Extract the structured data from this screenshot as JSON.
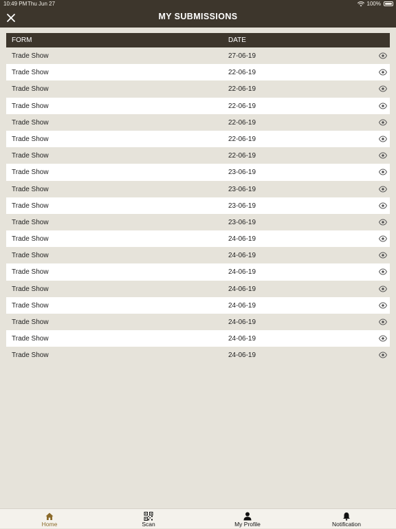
{
  "status": {
    "time": "10:49 PM",
    "date": "Thu Jun 27",
    "battery": "100%"
  },
  "nav": {
    "title": "MY SUBMISSIONS",
    "close_icon": "close-icon"
  },
  "table": {
    "headers": {
      "form": "FORM",
      "date": "DATE"
    },
    "rows": [
      {
        "form": "Trade Show",
        "date": "27-06-19"
      },
      {
        "form": "Trade Show",
        "date": "22-06-19"
      },
      {
        "form": "Trade Show",
        "date": "22-06-19"
      },
      {
        "form": "Trade Show",
        "date": "22-06-19"
      },
      {
        "form": "Trade Show",
        "date": "22-06-19"
      },
      {
        "form": "Trade Show",
        "date": "22-06-19"
      },
      {
        "form": "Trade Show",
        "date": "22-06-19"
      },
      {
        "form": "Trade Show",
        "date": "23-06-19"
      },
      {
        "form": "Trade Show",
        "date": "23-06-19"
      },
      {
        "form": "Trade Show",
        "date": "23-06-19"
      },
      {
        "form": "Trade Show",
        "date": "23-06-19"
      },
      {
        "form": "Trade Show",
        "date": "24-06-19"
      },
      {
        "form": "Trade Show",
        "date": "24-06-19"
      },
      {
        "form": "Trade Show",
        "date": "24-06-19"
      },
      {
        "form": "Trade Show",
        "date": "24-06-19"
      },
      {
        "form": "Trade Show",
        "date": "24-06-19"
      },
      {
        "form": "Trade Show",
        "date": "24-06-19"
      },
      {
        "form": "Trade Show",
        "date": "24-06-19"
      },
      {
        "form": "Trade Show",
        "date": "24-06-19"
      }
    ],
    "row_icon": "eye-icon"
  },
  "tabs": [
    {
      "label": "Home",
      "icon": "home-icon",
      "active": true
    },
    {
      "label": "Scan",
      "icon": "qr-code-icon",
      "active": false
    },
    {
      "label": "My Profile",
      "icon": "person-icon",
      "active": false
    },
    {
      "label": "Notification",
      "icon": "bell-icon",
      "active": false
    }
  ],
  "colors": {
    "header_bg": "#3d362c",
    "page_bg": "#e6e3da",
    "row_alt": "#ffffff",
    "active_tab": "#8a6a2a"
  }
}
